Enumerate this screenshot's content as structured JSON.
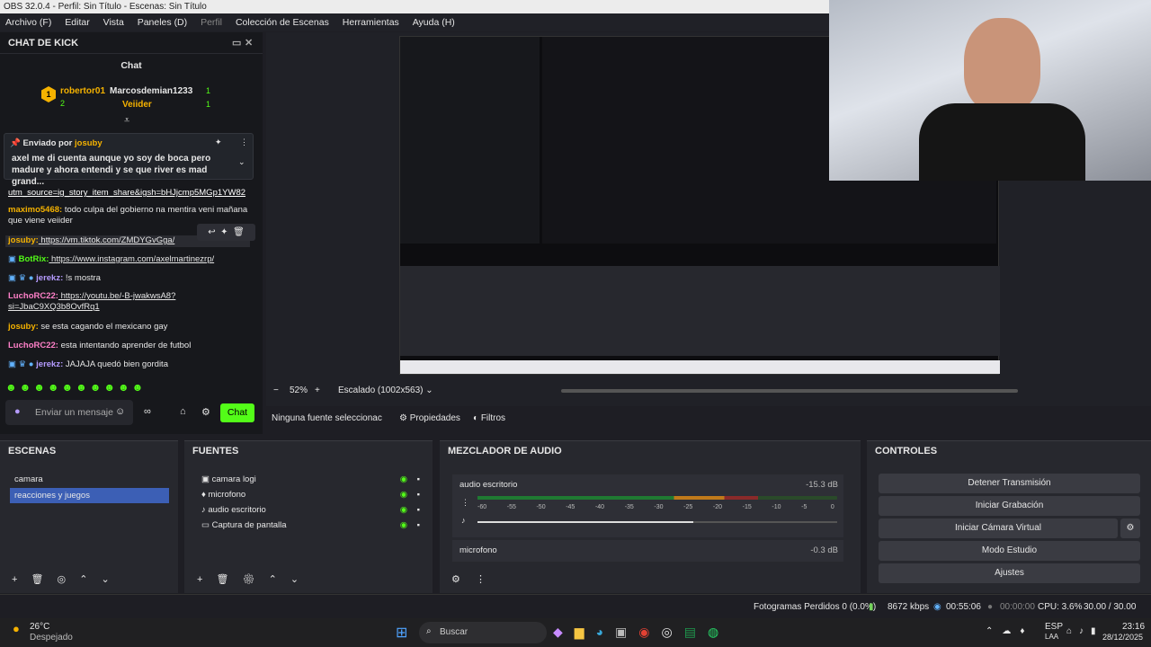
{
  "window": {
    "title": "OBS 32.0.4 - Perfil: Sin Título - Escenas: Sin Título"
  },
  "menu": [
    "Archivo (F)",
    "Editar",
    "Vista",
    "Paneles (D)",
    "Perfil",
    "Colección de Escenas",
    "Herramientas",
    "Ayuda (H)"
  ],
  "chat": {
    "panel_title": "CHAT DE KICK",
    "tab": "Chat",
    "leaders": [
      {
        "name": "robertor01",
        "count": "1"
      },
      {
        "name": "Marcosdemian1233",
        "count": "1"
      },
      {
        "name": "Veiider",
        "count": "1"
      },
      {
        "name": "",
        "count": "2"
      }
    ],
    "leader2count": "1",
    "pinned": {
      "by_label": "Enviado por",
      "by_user": "josuby",
      "text": "axel me di cuenta aunque yo soy de boca pero madure y ahora entendi y se que river es mad grand..."
    },
    "messages": [
      {
        "user": "",
        "text": "utm_source=ig_story_item_share&igsh=bHJjcmp5MGp1YW82"
      },
      {
        "user": "maximo5468:",
        "text": " todo culpa del gobierno na mentira veni mañana que viene veiider"
      },
      {
        "user": "josuby:",
        "text": " https://vm.tiktok.com/ZMDYGvGga/"
      },
      {
        "user": "BotRix:",
        "text": " https://www.instagram.com/axelmartinezrp/"
      },
      {
        "user": "jerekz:",
        "text": " !s mostra"
      },
      {
        "user": "LuchoRC22:",
        "text": " https://youtu.be/-B-jwakwsA8?si=JbaC9XQ3b8OvfRq1"
      },
      {
        "user": "josuby:",
        "text": " se esta cagando el mexicano gay"
      },
      {
        "user": "LuchoRC22:",
        "text": " esta intentando aprender de futbol"
      },
      {
        "user": "jerekz:",
        "text": " JAJAJA quedó bien gordita"
      }
    ],
    "input_placeholder": "Enviar un mensaje",
    "send": "Chat"
  },
  "preview": {
    "zoom": "52%",
    "minus": "−",
    "plus": "+",
    "scale": "Escalado (1002x563)"
  },
  "sourcebar": {
    "none": "Ninguna fuente seleccionac",
    "props": "Propiedades",
    "filters": "Filtros"
  },
  "scenes": {
    "title": "ESCENAS",
    "items": [
      "camara",
      "reacciones y juegos"
    ]
  },
  "sources": {
    "title": "FUENTES",
    "items": [
      "camara logi",
      "microfono",
      "audio escritorio",
      "Captura de pantalla"
    ]
  },
  "mixer": {
    "title": "MEZCLADOR DE AUDIO",
    "ch1": {
      "name": "audio escritorio",
      "db": "-15.3 dB"
    },
    "ch2": {
      "name": "microfono",
      "db": "-0.3 dB"
    },
    "ticks": [
      "-60",
      "-55",
      "-50",
      "-45",
      "-40",
      "-35",
      "-30",
      "-25",
      "-20",
      "-15",
      "-10",
      "-5",
      "0"
    ],
    "ch1_level": 0.78,
    "vol1": 0.6
  },
  "controls": {
    "title": "CONTROLES",
    "buttons": [
      "Detener Transmisión",
      "Iniciar Grabación",
      "Iniciar Cámara Virtual",
      "Modo Estudio",
      "Ajustes"
    ]
  },
  "status": {
    "frames": "Fotogramas Perdidos 0 (0.0%)",
    "kbps": "8672 kbps",
    "live": "00:55:06",
    "rec": "00:00:00",
    "cpu": "CPU: 3.6%",
    "fps": "30.00 / 30.00 FPS"
  },
  "taskbar": {
    "weather_temp": "26°C",
    "weather_desc": "Despejado",
    "search": "Buscar",
    "lang1": "ESP",
    "lang2": "LAA",
    "time": "23:16",
    "date": "28/12/2025"
  },
  "colors": {
    "kick_green": "#53fc18",
    "accent": "#3c5fb5"
  }
}
